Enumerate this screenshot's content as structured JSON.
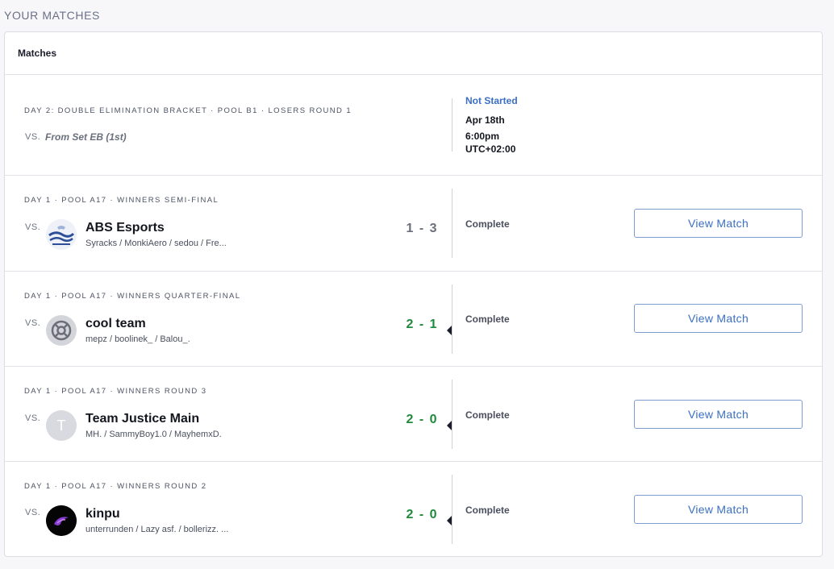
{
  "page": {
    "heading": "YOUR MATCHES"
  },
  "card": {
    "title": "Matches"
  },
  "upcoming": {
    "round_label": "DAY 2: DOUBLE ELIMINATION BRACKET · POOL B1 · LOSERS ROUND 1",
    "vs": "VS.",
    "opponent": "From Set EB (1st)",
    "status": "Not Started",
    "date": "Apr 18th",
    "time": "6:00pm",
    "timezone": "UTC+02:00"
  },
  "matches": [
    {
      "round_label": "DAY 1 · POOL A17 · WINNERS SEMI-FINAL",
      "vs": "VS.",
      "team": "ABS Esports",
      "roster": "Syracks / MonkiAero / sedou / Fre...",
      "score": "1 - 3",
      "result": "loss",
      "status": "Complete",
      "button": "View Match",
      "logo_icon": "abs-esports-logo-icon"
    },
    {
      "round_label": "DAY 1 · POOL A17 · WINNERS QUARTER-FINAL",
      "vs": "VS.",
      "team": "cool team",
      "roster": "mepz / boolinek_ / Balou_.",
      "score": "2 - 1",
      "result": "win",
      "status": "Complete",
      "button": "View Match",
      "logo_icon": "cool-team-logo-icon"
    },
    {
      "round_label": "DAY 1 · POOL A17 · WINNERS ROUND 3",
      "vs": "VS.",
      "team": "Team Justice Main",
      "roster": "MH. / SammyBoy1.0 / MayhemxD.",
      "score": "2 - 0",
      "result": "win",
      "status": "Complete",
      "button": "View Match",
      "logo_letter": "T"
    },
    {
      "round_label": "DAY 1 · POOL A17 · WINNERS ROUND 2",
      "vs": "VS.",
      "team": "kinpu",
      "roster": "unterrunden / Lazy asf. / bollerizz. ...",
      "score": "2 - 0",
      "result": "win",
      "status": "Complete",
      "button": "View Match",
      "logo_icon": "kinpu-logo-icon"
    }
  ],
  "colors": {
    "accent": "#3a6fc4",
    "win": "#1f8a3a",
    "loss": "#6b6f7b",
    "border": "#dcdde3"
  }
}
